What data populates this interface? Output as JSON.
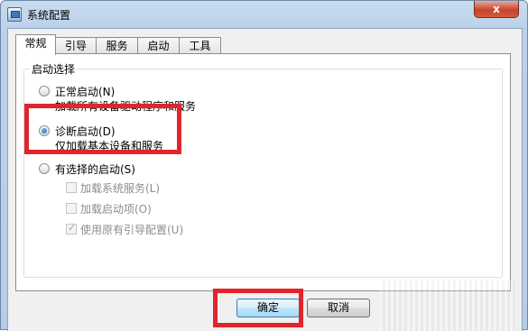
{
  "window": {
    "title": "系统配置",
    "close_glyph": "x"
  },
  "tabs": [
    {
      "label": "常规",
      "active": true
    },
    {
      "label": "引导",
      "active": false
    },
    {
      "label": "服务",
      "active": false
    },
    {
      "label": "启动",
      "active": false
    },
    {
      "label": "工具",
      "active": false
    }
  ],
  "startup_selection": {
    "group_title": "启动选择",
    "options": [
      {
        "label": "正常启动(N)",
        "description": "加载所有设备驱动程序和服务",
        "selected": false
      },
      {
        "label": "诊断启动(D)",
        "description": "仅加载基本设备和服务",
        "selected": true
      },
      {
        "label": "有选择的启动(S)",
        "selected": false
      }
    ],
    "sub_options": [
      {
        "label": "加载系统服务(L)",
        "checked": false,
        "enabled": false
      },
      {
        "label": "加载启动项(O)",
        "checked": false,
        "enabled": false
      },
      {
        "label": "使用原有引导配置(U)",
        "checked": true,
        "enabled": false
      }
    ]
  },
  "buttons": {
    "ok": "确定",
    "cancel": "取消"
  },
  "highlight_color": "#e0252b"
}
